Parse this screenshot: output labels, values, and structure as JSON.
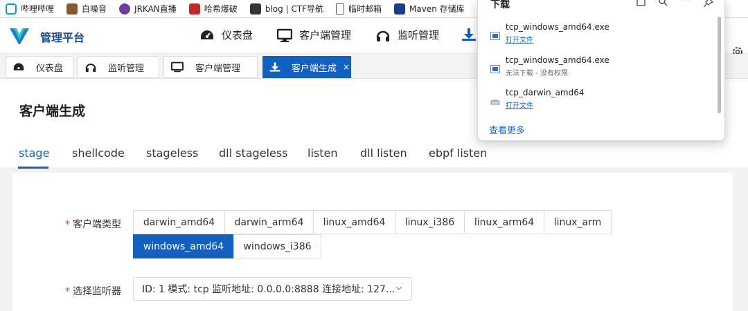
{
  "bookmarks": [
    {
      "label": "哔哩哔哩",
      "icon": "bilibili-icon",
      "color": "#00a1d6"
    },
    {
      "label": "白噪音",
      "icon": "white-noise-icon",
      "color": "#8b5a2b"
    },
    {
      "label": "JRKAN直播",
      "icon": "jrkan-icon",
      "color": "#6a3fa0"
    },
    {
      "label": "哈希爆破",
      "icon": "hash-crack-icon",
      "color": "#c62828"
    },
    {
      "label": "blog | CTF导航",
      "icon": "blog-icon",
      "color": "#333333"
    },
    {
      "label": "临时邮箱",
      "icon": "document-icon",
      "color": "#666666"
    },
    {
      "label": "Maven 存储库",
      "icon": "maven-icon",
      "color": "#1e3a8a"
    }
  ],
  "header": {
    "brand": "管理平台",
    "nav": [
      {
        "label": "仪表盘",
        "icon": "dashboard-icon"
      },
      {
        "label": "客户端管理",
        "icon": "monitor-icon"
      },
      {
        "label": "监听管理",
        "icon": "headphones-icon"
      }
    ]
  },
  "tabs": [
    {
      "label": "仪表盘",
      "icon": "dashboard-icon",
      "active": false
    },
    {
      "label": "监听管理",
      "icon": "headphones-icon",
      "active": false
    },
    {
      "label": "客户端管理",
      "icon": "monitor-icon",
      "active": false
    },
    {
      "label": "客户端生成",
      "icon": "download-icon",
      "active": true,
      "close": "×"
    }
  ],
  "page": {
    "title": "客户端生成",
    "subtabs": [
      "stage",
      "shellcode",
      "stageless",
      "dll stageless",
      "listen",
      "dll listen",
      "ebpf listen"
    ],
    "active_subtab": "stage"
  },
  "form": {
    "client_type_label": "客户端类型",
    "required_mark": "*",
    "client_types": [
      "darwin_amd64",
      "darwin_arm64",
      "linux_amd64",
      "linux_i386",
      "linux_arm64",
      "linux_arm",
      "windows_amd64",
      "windows_i386"
    ],
    "selected_client_type": "windows_amd64",
    "listener_label": "选择监听器",
    "listener_value": "ID: 1 模式: tcp 监听地址: 0.0.0.0:8888 连接地址: 127..."
  },
  "downloads": {
    "title": "下载",
    "items": [
      {
        "name": "tcp_windows_amd64.exe",
        "status": "打开文件",
        "kind": "link"
      },
      {
        "name": "tcp_windows_amd64.exe",
        "status": "无法下载 - 没有权限",
        "kind": "err"
      },
      {
        "name": "tcp_darwin_amd64",
        "status": "打开文件",
        "kind": "link"
      }
    ],
    "more": "查看更多"
  },
  "colors": {
    "accent": "#1260bf",
    "required": "#e4393c",
    "link": "#1a66c9"
  }
}
